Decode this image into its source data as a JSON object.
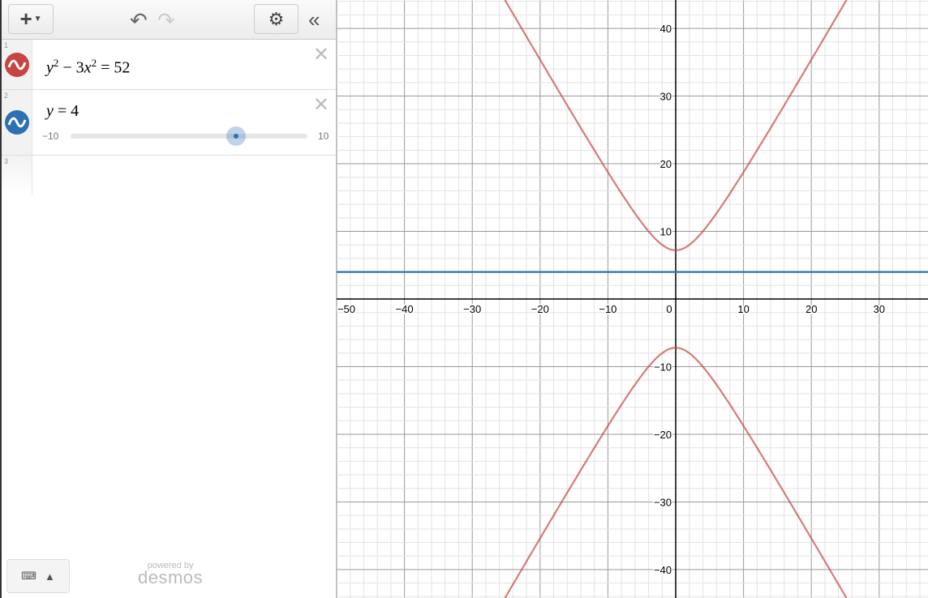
{
  "toolbar": {
    "add_icon": "plus-icon",
    "undo_icon": "undo-icon",
    "redo_icon": "redo-icon",
    "settings_icon": "gear-icon",
    "collapse_icon": "double-chevron-left-icon"
  },
  "expressions": [
    {
      "number": "1",
      "color": "#c74440",
      "y": "y",
      "exp1": "2",
      "mid": " − 3",
      "x": "x",
      "exp2": "2",
      "rhs": " = 52"
    },
    {
      "number": "2",
      "color": "#2d70b3",
      "latex_var": "y",
      "latex_rest": " = 4",
      "slider": {
        "min": "−10",
        "max": "10",
        "value": 4,
        "range": [
          -10,
          10
        ]
      }
    },
    {
      "number": "3"
    }
  ],
  "footer": {
    "powered_by": "powered by",
    "brand": "desmos"
  },
  "chart_data": {
    "type": "line",
    "xlim": [
      -50,
      37.2
    ],
    "ylim": [
      -44.2,
      44.2
    ],
    "grid": true,
    "x_ticks": [
      -50,
      -40,
      -30,
      -20,
      -10,
      0,
      10,
      20,
      30
    ],
    "y_ticks": [
      40,
      30,
      20,
      10,
      -10,
      -20,
      -30,
      -40
    ],
    "series": [
      {
        "name": "y^2 - 3x^2 = 52",
        "kind": "hyperbola",
        "a": 52,
        "b": 3,
        "color": "#c74440"
      },
      {
        "name": "y = 4",
        "kind": "horizontal",
        "y": 4,
        "color": "#2d70b3"
      }
    ]
  }
}
